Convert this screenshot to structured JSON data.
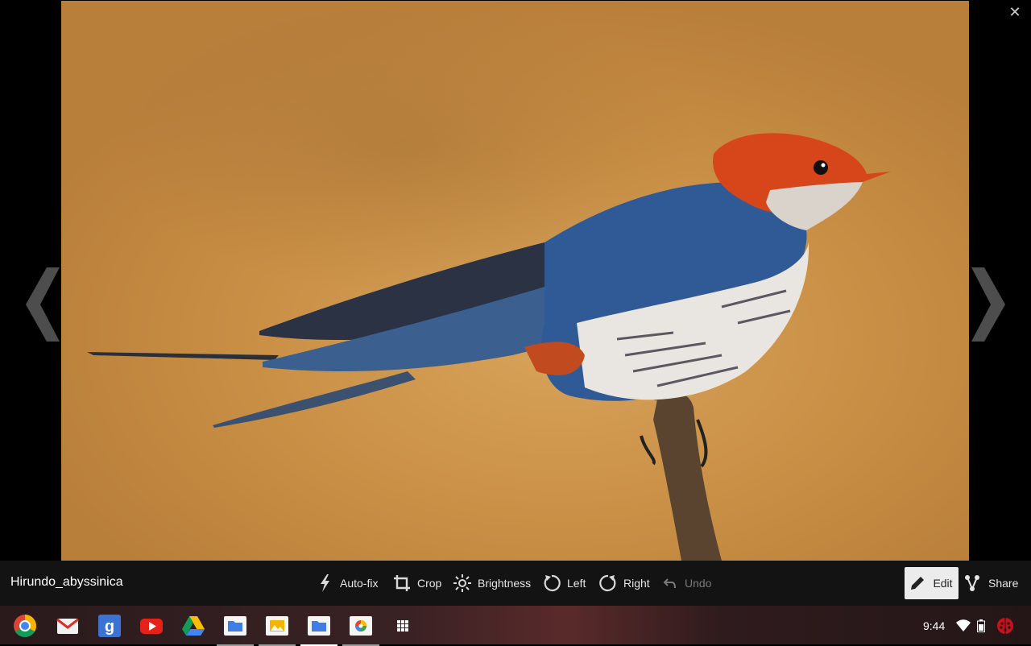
{
  "viewer": {
    "file_name": "Hirundo_abyssinica",
    "close_glyph": "✕",
    "image_subject": "bird-photo"
  },
  "toolbar": {
    "tools": [
      {
        "label": "Auto-fix",
        "icon": "auto-fix-icon",
        "enabled": true
      },
      {
        "label": "Crop",
        "icon": "crop-icon",
        "enabled": true
      },
      {
        "label": "Brightness",
        "icon": "brightness-icon",
        "enabled": true
      },
      {
        "label": "Left",
        "icon": "rotate-left-icon",
        "enabled": true
      },
      {
        "label": "Right",
        "icon": "rotate-right-icon",
        "enabled": true
      },
      {
        "label": "Undo",
        "icon": "undo-icon",
        "enabled": false
      }
    ],
    "edit_label": "Edit",
    "share_label": "Share"
  },
  "shelf": {
    "apps": [
      {
        "name": "chrome",
        "icon": "chrome-icon"
      },
      {
        "name": "gmail",
        "icon": "gmail-icon"
      },
      {
        "name": "google-search",
        "icon": "google-icon"
      },
      {
        "name": "youtube",
        "icon": "youtube-icon"
      },
      {
        "name": "drive",
        "icon": "drive-icon"
      },
      {
        "name": "files",
        "icon": "files-icon",
        "running": true
      },
      {
        "name": "gallery",
        "icon": "gallery-icon",
        "running": true
      },
      {
        "name": "files-active",
        "icon": "files-icon",
        "running": true,
        "active": true
      },
      {
        "name": "picasa",
        "icon": "picasa-icon",
        "running": true
      },
      {
        "name": "app-launcher",
        "icon": "app-grid-icon"
      }
    ],
    "clock": "9:44",
    "tray_icons": [
      "wifi-icon",
      "battery-icon",
      "user-avatar-icon"
    ]
  },
  "colors": {
    "toolbar_bg": "#161616",
    "edit_active_bg": "#ececec",
    "photo_bg": "#d39a52"
  }
}
